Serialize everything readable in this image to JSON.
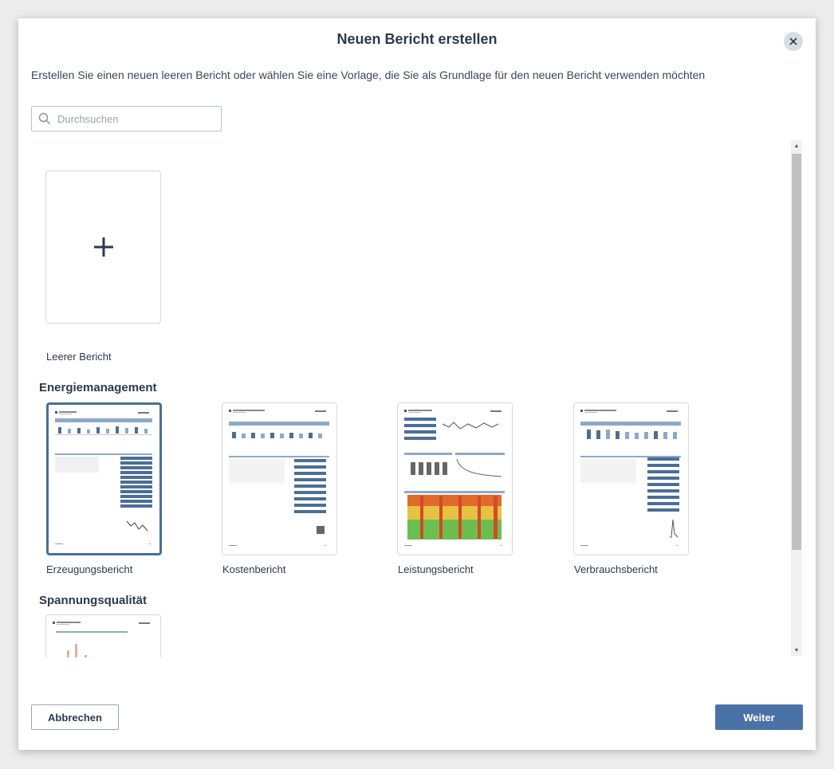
{
  "dialog": {
    "title": "Neuen Bericht erstellen",
    "description": "Erstellen Sie einen neuen leeren Bericht oder wählen Sie eine Vorlage, die Sie als Grundlage für den neuen Bericht verwenden möchten",
    "close_icon": "close-icon"
  },
  "search": {
    "placeholder": "Durchsuchen",
    "value": "",
    "icon": "search-icon"
  },
  "blank_report": {
    "label": "Leerer Bericht",
    "icon": "plus-icon"
  },
  "sections": [
    {
      "title": "Energiemanagement",
      "templates": [
        {
          "label": "Erzeugungsbericht",
          "selected": true
        },
        {
          "label": "Kostenbericht",
          "selected": false
        },
        {
          "label": "Leistungsbericht",
          "selected": false
        },
        {
          "label": "Verbrauchsbericht",
          "selected": false
        }
      ]
    },
    {
      "title": "Spannungsqualität",
      "templates": [
        {
          "label": "",
          "selected": false
        }
      ]
    }
  ],
  "footer": {
    "cancel_label": "Abbrechen",
    "next_label": "Weiter"
  },
  "colors": {
    "accent": "#4a72a6",
    "selected_border": "#4a6e98",
    "text": "#2b3a4c"
  }
}
